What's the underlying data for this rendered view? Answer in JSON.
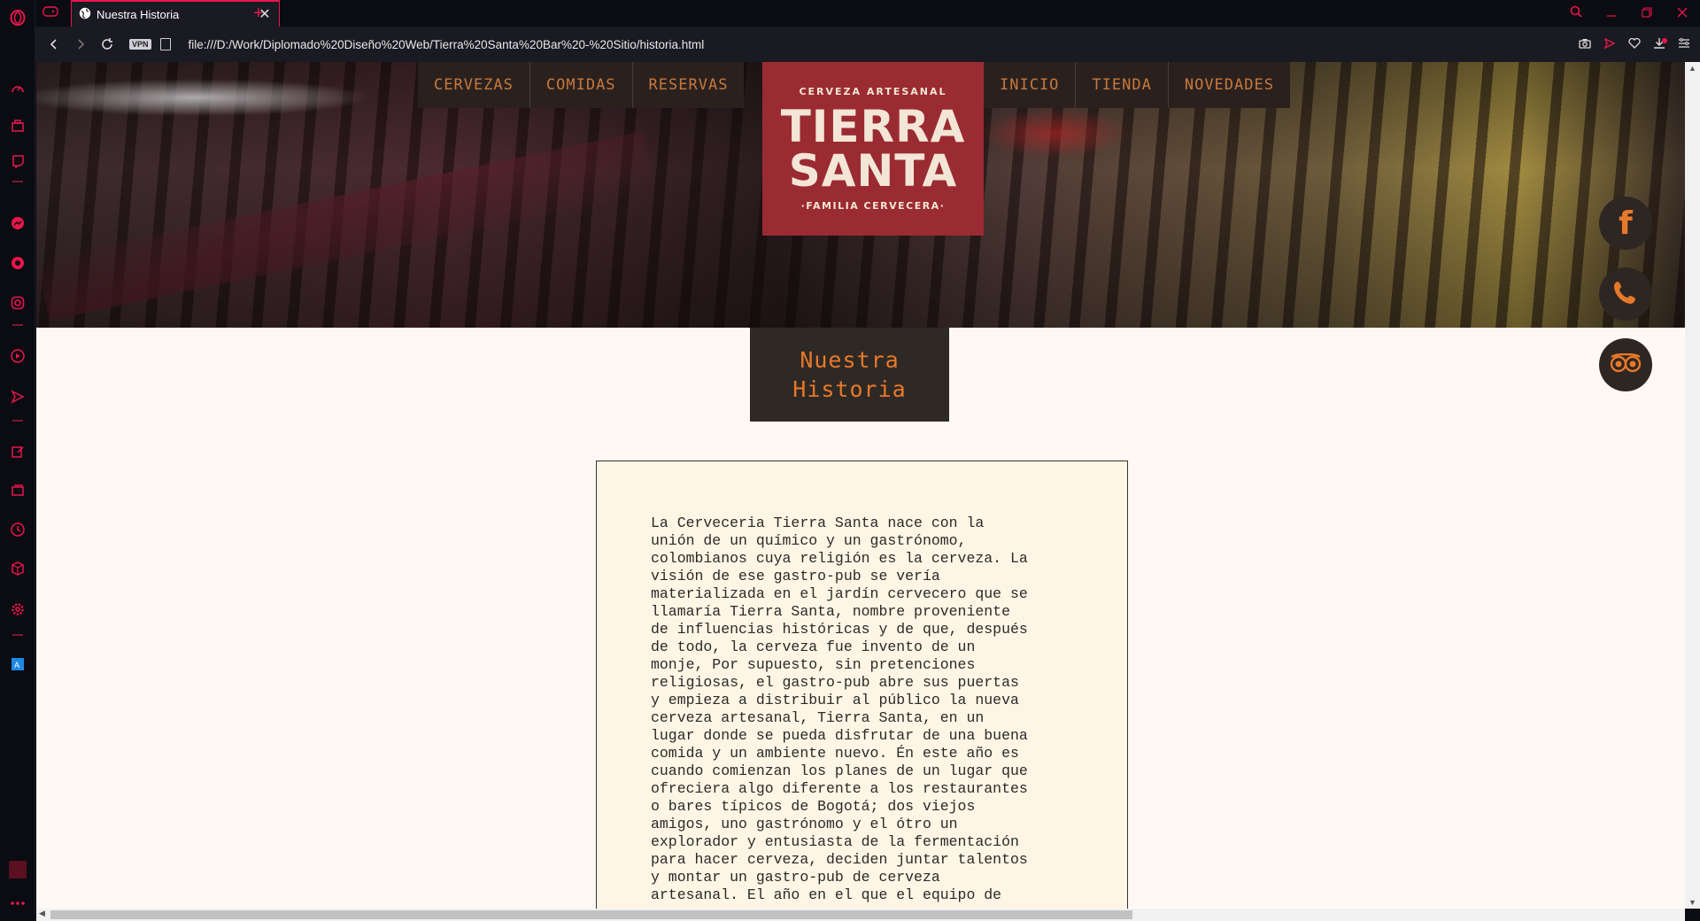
{
  "browser": {
    "tab_title": "Nuestra Historia",
    "tab_close": "✕",
    "new_tab": "+",
    "url": "file:///D:/Work/Diplomado%20Diseño%20Web/Tierra%20Santa%20Bar%20-%20Sitio/historia.html",
    "vpn_label": "VPN"
  },
  "site": {
    "nav_left": [
      "CERVEZAS",
      "COMIDAS",
      "RESERVAS"
    ],
    "nav_right": [
      "INICIO",
      "TIENDA",
      "NOVEDADES"
    ],
    "logo": {
      "top": "CERVEZA ARTESANAL",
      "line1": "TIERRA",
      "line2": "SANTA",
      "bottom": "·FAMILIA CERVECERA·"
    },
    "social_fb": "f",
    "page_title": "Nuestra Historia",
    "story_text": "La Cerveceria Tierra Santa nace con la\nunión de un químico y un gastrónomo,\ncolombianos cuya religión es la cerveza. La\nvisión de ese gastro-pub se vería\nmaterializada en el jardín cervecero que se\nllamaría Tierra Santa, nombre proveniente\nde influencias históricas y de que, después\nde todo, la cerveza fue invento de un\nmonje, Por supuesto, sin pretenciones\nreligiosas, el gastro-pub abre sus puertas\ny empieza a distribuir al público la nueva\ncerveza artesanal, Tierra Santa, en un\nlugar donde se pueda disfrutar de una buena\ncomida y un ambiente nuevo. Én este año es\ncuando comienzan los planes de un lugar que\nofreciera algo diferente a los restaurantes\no bares típicos de Bogotá; dos viejos\namigos, uno gastrónomo y el ótro un\nexplorador y entusiasta de la fermentación\npara hacer cerveza, deciden juntar talentos\ny montar un gastro-pub de cerveza\nartesanal. El año en el que el equipo de"
  },
  "colors": {
    "opera_accent": "#e8174a",
    "nav_text": "#c8783a",
    "logo_bg": "#9b2b32",
    "title_text": "#e8782a"
  }
}
